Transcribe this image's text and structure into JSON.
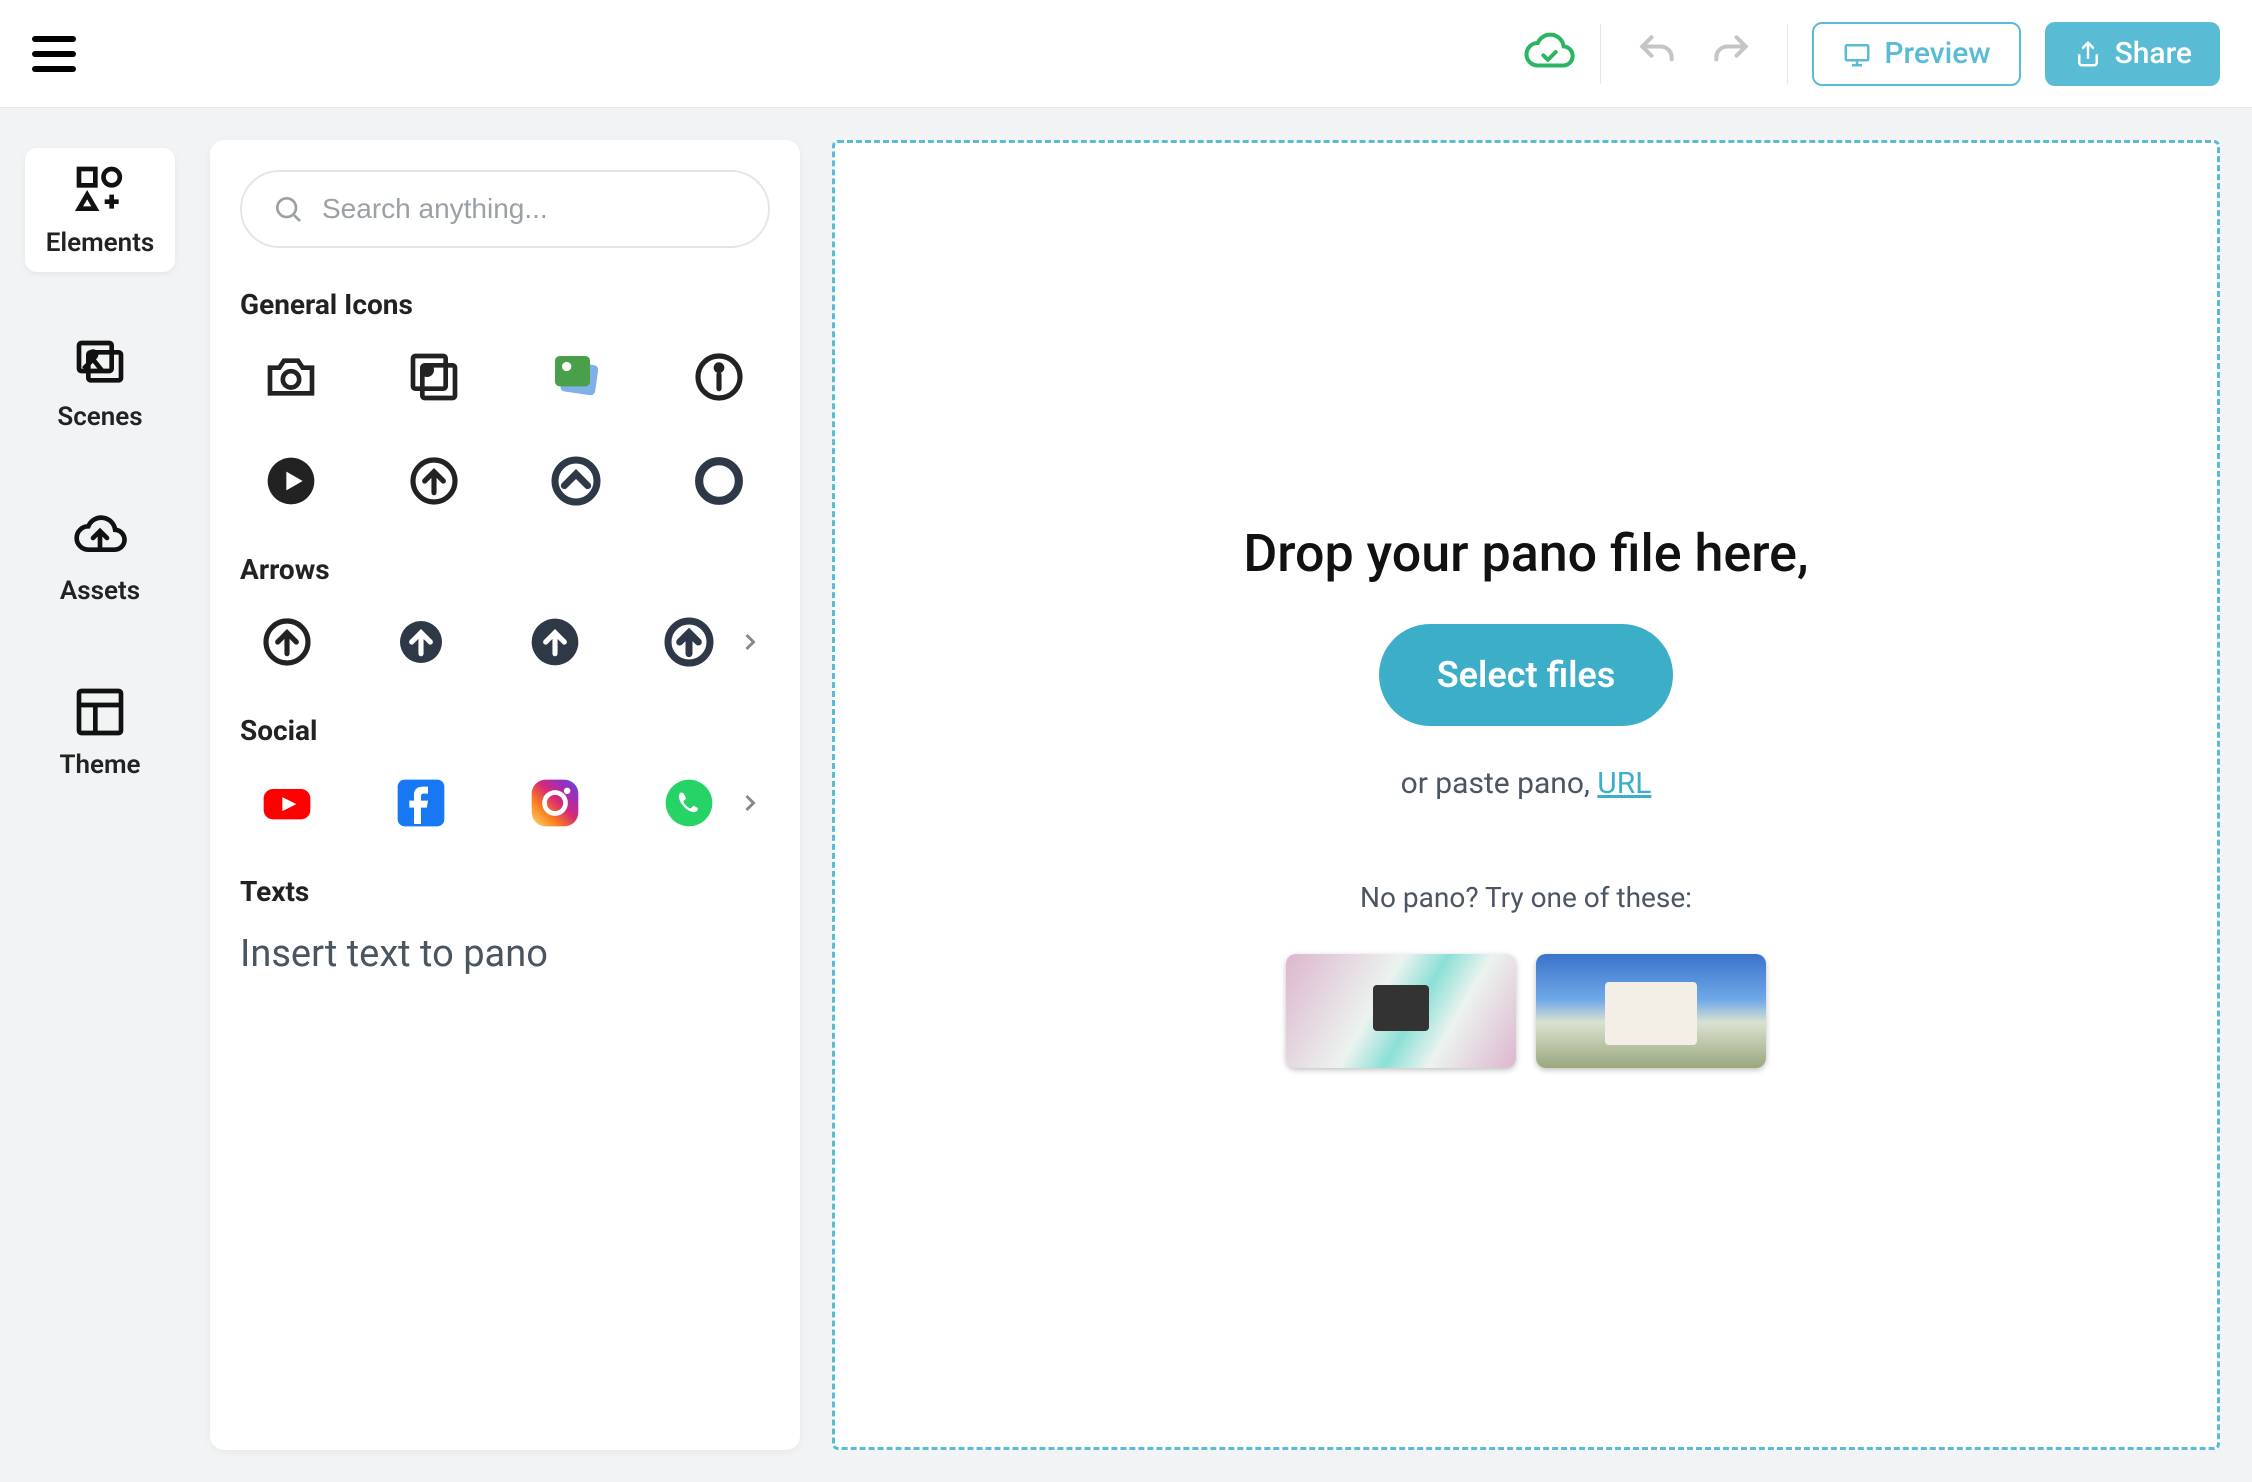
{
  "topbar": {
    "preview_label": "Preview",
    "share_label": "Share"
  },
  "rail": {
    "elements": "Elements",
    "scenes": "Scenes",
    "assets": "Assets",
    "theme": "Theme"
  },
  "panel": {
    "search_placeholder": "Search anything...",
    "sections": {
      "general": "General Icons",
      "arrows": "Arrows",
      "social": "Social",
      "texts": "Texts"
    },
    "general_icons": [
      "camera",
      "photo-stack",
      "picture",
      "info",
      "play",
      "up-circle-outline",
      "chevron-up-circle",
      "circle-outline"
    ],
    "arrow_icons": [
      "arrow-up-outline",
      "arrow-up-solid-small",
      "arrow-up-solid-large",
      "arrow-up-ring"
    ],
    "social_icons": [
      "youtube",
      "facebook",
      "instagram",
      "whatsapp"
    ],
    "insert_text": "Insert text to pano"
  },
  "dropzone": {
    "title": "Drop your pano file here,",
    "select_label": "Select files",
    "paste_prefix": "or paste pano, ",
    "paste_link": "URL",
    "try_label": "No pano? Try one of these:",
    "samples": [
      "interior-room",
      "exterior-building"
    ]
  },
  "colors": {
    "accent": "#59bcd4",
    "accent_dark": "#3daec8",
    "cloud_ok": "#2bb561"
  }
}
